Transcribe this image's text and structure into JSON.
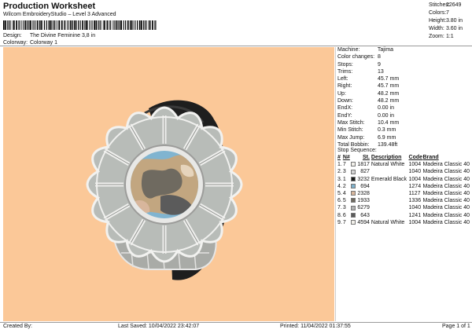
{
  "header": {
    "title": "Production Worksheet",
    "subtitle": "Wilcom EmbroideryStudio – Level 3 Advanced",
    "design_label": "Design:",
    "design_value": "The Divine Feminine 3,8 in",
    "colorway_label": "Colorway:",
    "colorway_value": "Colorway 1"
  },
  "summary": [
    {
      "label": "Stitches:",
      "value": "22649"
    },
    {
      "label": "Colors:",
      "value": "7"
    },
    {
      "label": "Height:",
      "value": "3.80 in"
    },
    {
      "label": "Width:",
      "value": "3.60 in"
    },
    {
      "label": "Zoom:",
      "value": "1:1"
    }
  ],
  "details": [
    {
      "label": "Machine:",
      "value": "Tajima"
    },
    {
      "label": "Color changes:",
      "value": "8"
    },
    {
      "label": "Stops:",
      "value": "9"
    },
    {
      "label": "Trims:",
      "value": "13"
    },
    {
      "label": "Left:",
      "value": "45.7 mm"
    },
    {
      "label": "Right:",
      "value": "45.7 mm"
    },
    {
      "label": "Up:",
      "value": "48.2 mm"
    },
    {
      "label": "Down:",
      "value": "48.2 mm"
    },
    {
      "label": "EndX:",
      "value": "0.00 in"
    },
    {
      "label": "EndY:",
      "value": "0.00 in"
    },
    {
      "label": "Max Stitch:",
      "value": "10.4 mm"
    },
    {
      "label": "Min Stitch:",
      "value": "0.3 mm"
    },
    {
      "label": "Max Jump:",
      "value": "6.9 mm"
    },
    {
      "label": "Total Bobbin:",
      "value": "139.48ft"
    }
  ],
  "stop_sequence": {
    "label": "Stop Sequence:",
    "columns": [
      "#",
      "N#",
      "St.",
      "Description",
      "Code",
      "Brand"
    ],
    "rows": [
      {
        "num": "1.",
        "n": "7",
        "color": "#f2f0ea",
        "st": "1817",
        "desc": "Natural White",
        "code": "1004",
        "brand": "Madeira Classic 40"
      },
      {
        "num": "2.",
        "n": "3",
        "color": "#d3d3d3",
        "st": "827",
        "desc": "",
        "code": "1040",
        "brand": "Madeira Classic 40"
      },
      {
        "num": "3.",
        "n": "1",
        "color": "#1a1c1a",
        "st": "3232",
        "desc": "Emerald Black",
        "code": "1004",
        "brand": "Madeira Classic 40"
      },
      {
        "num": "4.",
        "n": "2",
        "color": "#7fb2cc",
        "st": "694",
        "desc": "",
        "code": "1274",
        "brand": "Madeira Classic 40"
      },
      {
        "num": "5.",
        "n": "4",
        "color": "#d8b69c",
        "st": "2328",
        "desc": "",
        "code": "1127",
        "brand": "Madeira Classic 40"
      },
      {
        "num": "6.",
        "n": "5",
        "color": "#6f6a60",
        "st": "1933",
        "desc": "",
        "code": "1336",
        "brand": "Madeira Classic 40"
      },
      {
        "num": "7.",
        "n": "3",
        "color": "#b3b3b3",
        "st": "6279",
        "desc": "",
        "code": "1040",
        "brand": "Madeira Classic 40"
      },
      {
        "num": "8.",
        "n": "6",
        "color": "#5b5b5b",
        "st": "643",
        "desc": "",
        "code": "1241",
        "brand": "Madeira Classic 40"
      },
      {
        "num": "9.",
        "n": "7",
        "color": "#f2f0ea",
        "st": "4594",
        "desc": "Natural White",
        "code": "1004",
        "brand": "Madeira Classic 40"
      }
    ]
  },
  "footer": {
    "created_by": "Created By:",
    "last_saved": "Last Saved: 10/04/2022 23:42:07",
    "printed": "Printed: 11/04/2022 01:37:55",
    "page": "Page 1 of 1"
  },
  "colors": {
    "canvas_background": "#fbc898",
    "hair": "#1e1e1e",
    "frame_silver": "#b8bcb8",
    "globe_blue": "#80b4d0",
    "camo_tan": "#c2a680"
  }
}
